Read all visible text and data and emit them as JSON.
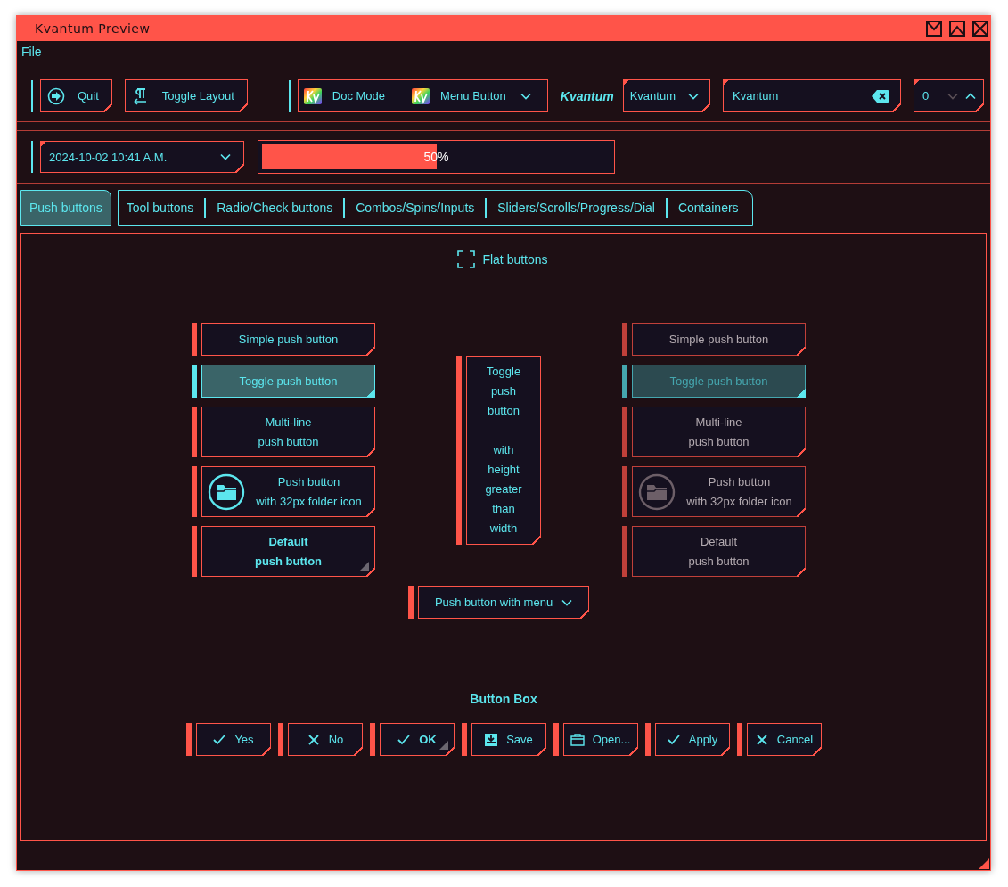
{
  "window": {
    "title": "Kvantum Preview"
  },
  "menu_bar": [
    {
      "label": "File"
    }
  ],
  "toolbar": {
    "buttons": [
      {
        "label": "Quit"
      },
      {
        "label": "Toggle Layout"
      }
    ],
    "doc_group": [
      {
        "label": "Doc Mode",
        "kind": "button"
      },
      {
        "label": "Menu Button",
        "kind": "menu"
      }
    ],
    "label": "Kvantum",
    "combo": {
      "value": "Kvantum"
    },
    "line_edit": {
      "value": "Kvantum"
    },
    "spin": {
      "value": "0",
      "down_disabled": true,
      "up_disabled": false
    }
  },
  "toolbar2": {
    "date_combo": {
      "value": "2024-10-02 10:41 A.M."
    },
    "progress": {
      "level": 0.5,
      "text": "50%"
    }
  },
  "tabs": [
    {
      "label": "Push buttons",
      "selected": true
    },
    {
      "label": "Tool buttons",
      "selected": false
    },
    {
      "label": "Radio/Check buttons",
      "selected": false
    },
    {
      "label": "Combos/Spins/Inputs",
      "selected": false
    },
    {
      "label": "Sliders/Scrolls/Progress/Dial",
      "selected": false
    },
    {
      "label": "Containers",
      "selected": false
    }
  ],
  "flat_buttons": {
    "label": "Flat buttons",
    "checked": false
  },
  "columns": [
    {
      "disabled": false,
      "buttons": [
        {
          "label": "Simple push button",
          "kind": "text",
          "checked": false,
          "default": false
        },
        {
          "label": "Toggle push button",
          "kind": "text",
          "checked": true,
          "default": false
        },
        {
          "label": "Multi-line\npush button",
          "kind": "text",
          "checked": false,
          "default": false
        },
        {
          "label": "Push button\nwith 32px folder icon",
          "kind": "icon",
          "checked": false,
          "default": false
        },
        {
          "label": "Default\npush button",
          "kind": "text",
          "checked": false,
          "default": true
        }
      ]
    },
    {
      "disabled": true,
      "buttons": [
        {
          "label": "Simple push button",
          "kind": "text",
          "checked": false,
          "default": false
        },
        {
          "label": "Toggle push button",
          "kind": "text",
          "checked": true,
          "default": false
        },
        {
          "label": "Multi-line\npush button",
          "kind": "text",
          "checked": false,
          "default": false
        },
        {
          "label": "Push button\nwith 32px folder icon",
          "kind": "icon",
          "checked": false,
          "default": false
        },
        {
          "label": "Default\npush button",
          "kind": "text",
          "checked": false,
          "default": false
        }
      ]
    }
  ],
  "tall_button": {
    "label": "Toggle\npush\nbutton\n\nwith\nheight\ngreater\nthan\nwidth",
    "checked": false
  },
  "menu_button": {
    "label": "Push button with menu"
  },
  "button_box": {
    "title": "Button Box",
    "buttons": [
      {
        "label": "Yes",
        "kind": "accept",
        "default": false
      },
      {
        "label": "No",
        "kind": "reject",
        "default": false
      },
      {
        "label": "OK",
        "kind": "accept",
        "default": true
      },
      {
        "label": "Save",
        "kind": "save",
        "default": false
      },
      {
        "label": "Open...",
        "kind": "open",
        "default": false
      },
      {
        "label": "Apply",
        "kind": "accept",
        "default": false
      },
      {
        "label": "Cancel",
        "kind": "reject",
        "default": false
      }
    ]
  }
}
